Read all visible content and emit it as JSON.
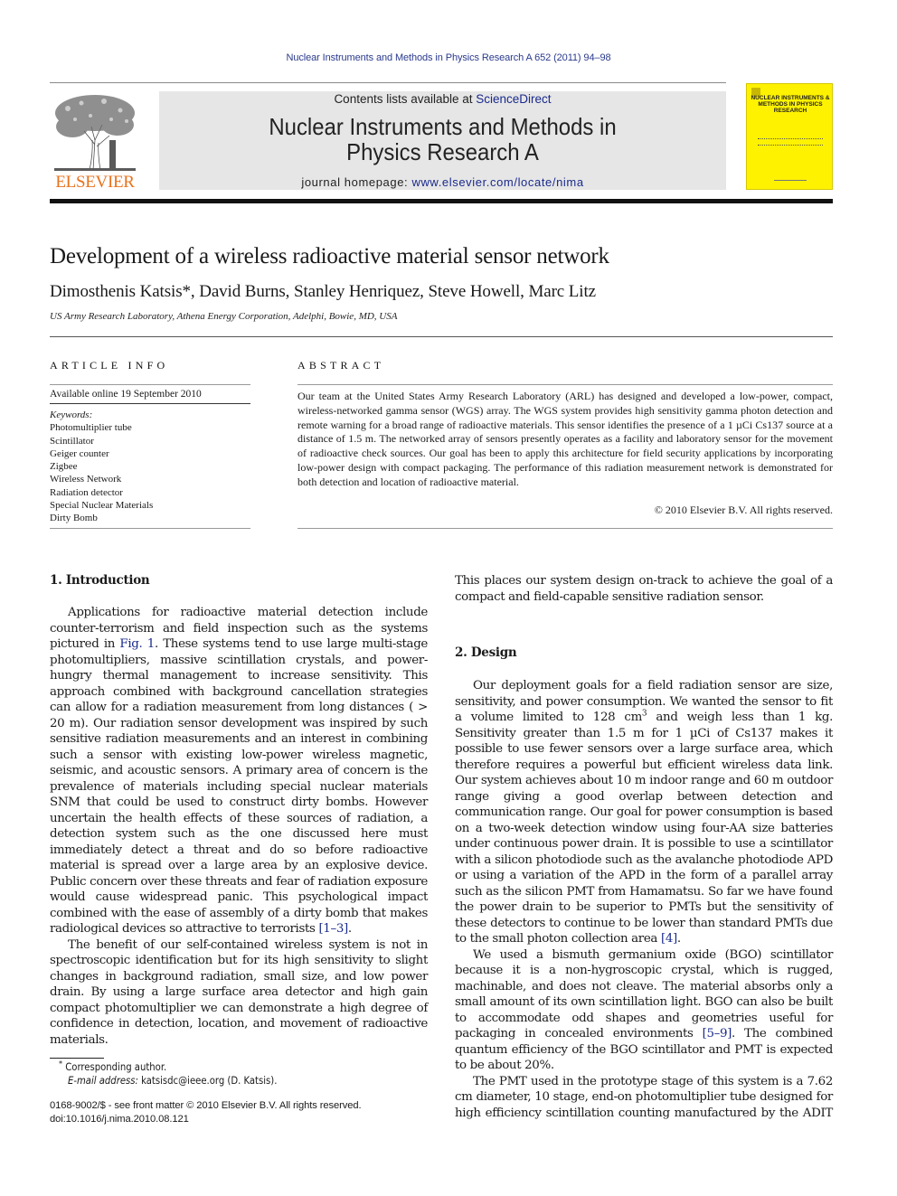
{
  "running_header": "Nuclear Instruments and Methods in Physics Research A 652 (2011) 94–98",
  "masthead": {
    "publisher_logo_text": "ELSEVIER",
    "contents_prefix": "Contents lists available at ",
    "contents_link": "ScienceDirect",
    "journal_title_line1": "Nuclear Instruments and Methods in",
    "journal_title_line2": "Physics Research A",
    "homepage_prefix": "journal homepage: ",
    "homepage_link": "www.elsevier.com/locate/nima",
    "cover_title": "NUCLEAR INSTRUMENTS & METHODS IN PHYSICS RESEARCH",
    "colors": {
      "publisher_orange": "#e9711c",
      "link_blue": "#1a2a8c",
      "cover_yellow": "#fff200",
      "masthead_gray": "#e6e6e6"
    }
  },
  "article": {
    "title": "Development of a wireless radioactive material sensor network",
    "authors": "Dimosthenis Katsis*, David Burns, Stanley Henriquez, Steve Howell, Marc Litz",
    "affiliation": "US Army Research Laboratory, Athena Energy Corporation, Adelphi, Bowie, MD, USA"
  },
  "article_info": {
    "heading": "ARTICLE INFO",
    "available_online": "Available online 19 September 2010",
    "keywords_label": "Keywords:",
    "keywords": [
      "Photomultiplier tube",
      "Scintillator",
      "Geiger counter",
      "Zigbee",
      "Wireless Network",
      "Radiation detector",
      "Special Nuclear Materials",
      "Dirty Bomb"
    ]
  },
  "abstract": {
    "heading": "ABSTRACT",
    "text": "Our team at the United States Army Research Laboratory (ARL) has designed and developed a low-power, compact, wireless-networked gamma sensor (WGS) array. The WGS system provides high sensitivity gamma photon detection and remote warning for a broad range of radioactive materials. This sensor identifies the presence of a 1 µCi Cs137 source at a distance of 1.5 m. The networked array of sensors presently operates as a facility and laboratory sensor for the movement of radioactive check sources. Our goal has been to apply this architecture for field security applications by incorporating low-power design with compact packaging. The performance of this radiation measurement network is demonstrated for both detection and location of radioactive material.",
    "copyright": "© 2010 Elsevier B.V. All rights reserved."
  },
  "sections": {
    "intro": {
      "heading": "1.  Introduction",
      "p1_a": "Applications for radioactive material detection include counter-terrorism and field inspection such as the systems pictured in ",
      "p1_fig_link": "Fig. 1",
      "p1_b": ". These systems tend to use large multi-stage photomultipliers, massive scintillation crystals, and power-hungry thermal management to increase sensitivity. This approach combined with background cancellation strategies can allow for a radiation measurement from long distances ( > 20 m). Our radiation sensor development was inspired by such sensitive radiation measurements and an interest in combining such a sensor with existing low-power wireless magnetic, seismic, and acoustic sensors. A primary area of concern is the prevalence of materials including special nuclear materials SNM that could be used to construct dirty bombs. However uncertain the health effects of these sources of radiation, a detection system such as the one discussed here must immediately detect a threat and do so before radioactive material is spread over a large area by an explosive device. Public concern over these threats and fear of radiation exposure would cause widespread panic. This psychological impact combined with the ease of assembly of a dirty bomb that makes radiological devices so attractive to terrorists ",
      "p1_ref_link": "[1–3]",
      "p1_c": ".",
      "p2": "The benefit of our self-contained wireless system is not in spectroscopic identification but for its high sensitivity to slight changes in background radiation, small size, and low power drain. By using a large surface area detector and high gain compact photomultiplier we can demonstrate a high degree of confidence in detection, location, and movement of radioactive materials.",
      "p2_cont": "This places our system design on-track to achieve the goal of a compact and field-capable sensitive radiation sensor."
    },
    "design": {
      "heading": "2.  Design",
      "p1_a": "Our deployment goals for a field radiation sensor are size, sensitivity, and power consumption. We wanted the sensor to fit a volume limited to 128 cm",
      "p1_sup": "3",
      "p1_b": " and weigh less than 1 kg. Sensitivity greater than 1.5 m for 1 µCi of Cs137 makes it possible to use fewer sensors over a large surface area, which therefore requires a powerful but efficient wireless data link. Our system achieves about 10 m indoor range and 60 m outdoor range giving a good overlap between detection and communication range. Our goal for power consumption is based on a two-week detection window using four-AA size batteries under continuous power drain. It is possible to use a scintillator with a silicon photodiode such as the avalanche photodiode APD or using a variation of the APD in the form of a parallel array such as the silicon PMT from Hamamatsu. So far we have found the power drain to be superior to PMTs but the sensitivity of these detectors to continue to be lower than standard PMTs due to the small photon collection area ",
      "p1_ref_link": "[4]",
      "p1_c": ".",
      "p2_a": "We used a bismuth germanium oxide (BGO) scintillator because it is a non-hygroscopic crystal, which is rugged, machinable, and does not cleave. The material absorbs only a small amount of its own scintillation light. BGO can also be built to accommodate odd shapes and geometries useful for packaging in concealed environments ",
      "p2_ref_link": "[5–9]",
      "p2_b": ". The combined quantum efficiency of the BGO scintillator and PMT is expected to be about 20%.",
      "p3": "The PMT used in the prototype stage of this system is a 7.62 cm diameter, 10 stage, end-on photomultiplier tube designed for high efficiency scintillation counting manufactured by the ADIT"
    }
  },
  "footnote": {
    "marker": "*",
    "corresponding": "Corresponding author.",
    "email_label": "E-mail address:",
    "email": "katsisdc@ieee.org",
    "email_suffix": " (D. Katsis)."
  },
  "front_matter": {
    "line1": "0168-9002/$ - see front matter © 2010 Elsevier B.V. All rights reserved.",
    "doi": "doi:10.1016/j.nima.2010.08.121"
  }
}
